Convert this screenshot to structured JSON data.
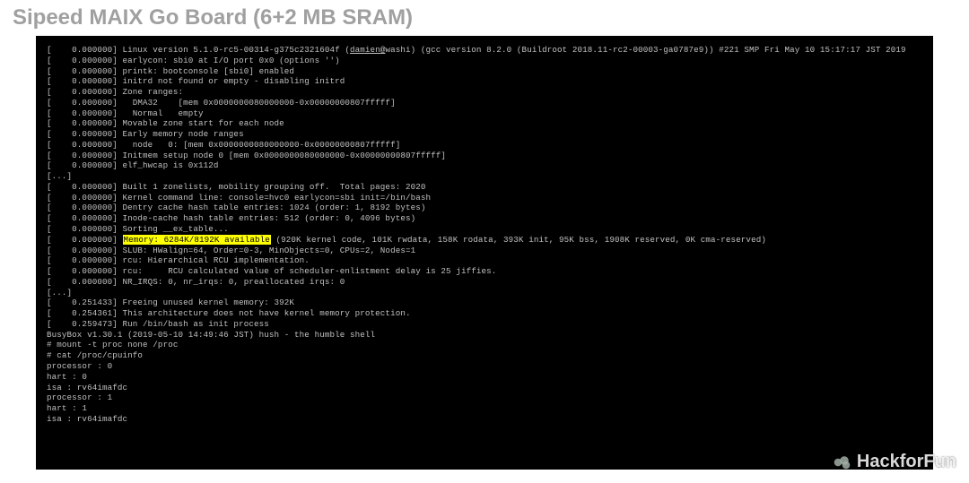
{
  "title": "Sipeed MAIX Go Board (6+2 MB SRAM)",
  "highlight": "Memory: 6284K/8192K available",
  "watermark": "HackforFun",
  "lines": [
    {
      "t": "[    0.000000] Linux version 5.1.0-rc5-00314-g375c2321604f (",
      "parts": [
        {
          "u": "damien@"
        },
        {
          "p": "washi) (gcc version 8.2.0 (Buildroot 2018.11-rc2-00003-ga0787e9)) #221 SMP Fri May 10 15:17:17 JST 2019"
        }
      ]
    },
    {
      "t": "[    0.000000] earlycon: sbi0 at I/O port 0x0 (options '')"
    },
    {
      "t": "[    0.000000] printk: bootconsole [sbi0] enabled"
    },
    {
      "t": "[    0.000000] initrd not found or empty - disabling initrd"
    },
    {
      "t": "[    0.000000] Zone ranges:"
    },
    {
      "t": "[    0.000000]   DMA32    [mem 0x0000000080000000-0x00000000807fffff]"
    },
    {
      "t": "[    0.000000]   Normal   empty"
    },
    {
      "t": "[    0.000000] Movable zone start for each node"
    },
    {
      "t": "[    0.000000] Early memory node ranges"
    },
    {
      "t": "[    0.000000]   node   0: [mem 0x0000000080000000-0x00000000807fffff]"
    },
    {
      "t": "[    0.000000] Initmem setup node 0 [mem 0x0000000080000000-0x00000000807fffff]"
    },
    {
      "t": "[    0.000000] elf_hwcap is 0x112d"
    },
    {
      "t": "[...]"
    },
    {
      "t": "[    0.000000] Built 1 zonelists, mobility grouping off.  Total pages: 2020"
    },
    {
      "t": "[    0.000000] Kernel command line: console=hvc0 earlycon=sbi init=/bin/bash"
    },
    {
      "t": "[    0.000000] Dentry cache hash table entries: 1024 (order: 1, 8192 bytes)"
    },
    {
      "t": "[    0.000000] Inode-cache hash table entries: 512 (order: 0, 4096 bytes)"
    },
    {
      "t": "[    0.000000] Sorting __ex_table..."
    },
    {
      "t": "[    0.000000] ",
      "hl": true,
      "rest": " (920K kernel code, 101K rwdata, 158K rodata, 393K init, 95K bss, 1908K reserved, 0K cma-reserved)"
    },
    {
      "t": "[    0.000000] SLUB: HWalign=64, Order=0-3, MinObjects=0, CPUs=2, Nodes=1"
    },
    {
      "t": "[    0.000000] rcu: Hierarchical RCU implementation."
    },
    {
      "t": "[    0.000000] rcu:     RCU calculated value of scheduler-enlistment delay is 25 jiffies."
    },
    {
      "t": "[    0.000000] NR_IRQS: 0, nr_irqs: 0, preallocated irqs: 0"
    },
    {
      "t": "[...]"
    },
    {
      "t": "[    0.251433] Freeing unused kernel memory: 392K"
    },
    {
      "t": "[    0.254361] This architecture does not have kernel memory protection."
    },
    {
      "t": "[    0.259473] Run /bin/bash as init process"
    },
    {
      "t": ""
    },
    {
      "t": "BusyBox v1.30.1 (2019-05-10 14:49:46 JST) hush - the humble shell"
    },
    {
      "t": ""
    },
    {
      "t": "# mount -t proc none /proc"
    },
    {
      "t": "# cat /proc/cpuinfo"
    },
    {
      "t": "processor : 0"
    },
    {
      "t": "hart : 0"
    },
    {
      "t": "isa : rv64imafdc"
    },
    {
      "t": ""
    },
    {
      "t": "processor : 1"
    },
    {
      "t": "hart : 1"
    },
    {
      "t": "isa : rv64imafdc"
    }
  ]
}
